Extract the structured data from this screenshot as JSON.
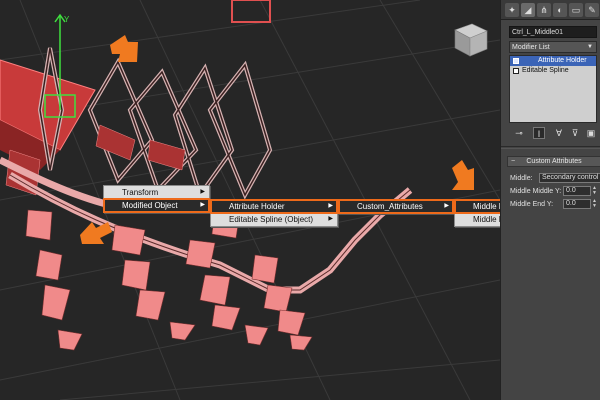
{
  "viewport": {
    "viewcube_label": "viewcube"
  },
  "menus": {
    "level1": [
      "Transform",
      "Modified Object"
    ],
    "level2": [
      "Attribute Holder",
      "Editable Spline (Object)"
    ],
    "level3": [
      "Custom_Attributes"
    ],
    "level4": [
      "Middle Middle Y",
      "Middle End Y"
    ]
  },
  "panel": {
    "object_name": "Ctrl_L_Middle01",
    "modifier_list_label": "Modifier List",
    "stack": [
      "Attribute Holder",
      "Editable Spline"
    ],
    "rollout_title": "Custom Attributes",
    "middle_label": "Middle:",
    "middle_value": "Secondary control",
    "middle_middle_y_label": "Middle Middle Y:",
    "middle_middle_y_value": "0.0",
    "middle_end_y_label": "Middle End Y:",
    "middle_end_y_value": "0.0"
  },
  "colors": {
    "highlight_outline": "#ee6a1a",
    "arrow": "#f07a20",
    "mesh": "#f08a8a",
    "selection_blue": "#3b64b7"
  }
}
